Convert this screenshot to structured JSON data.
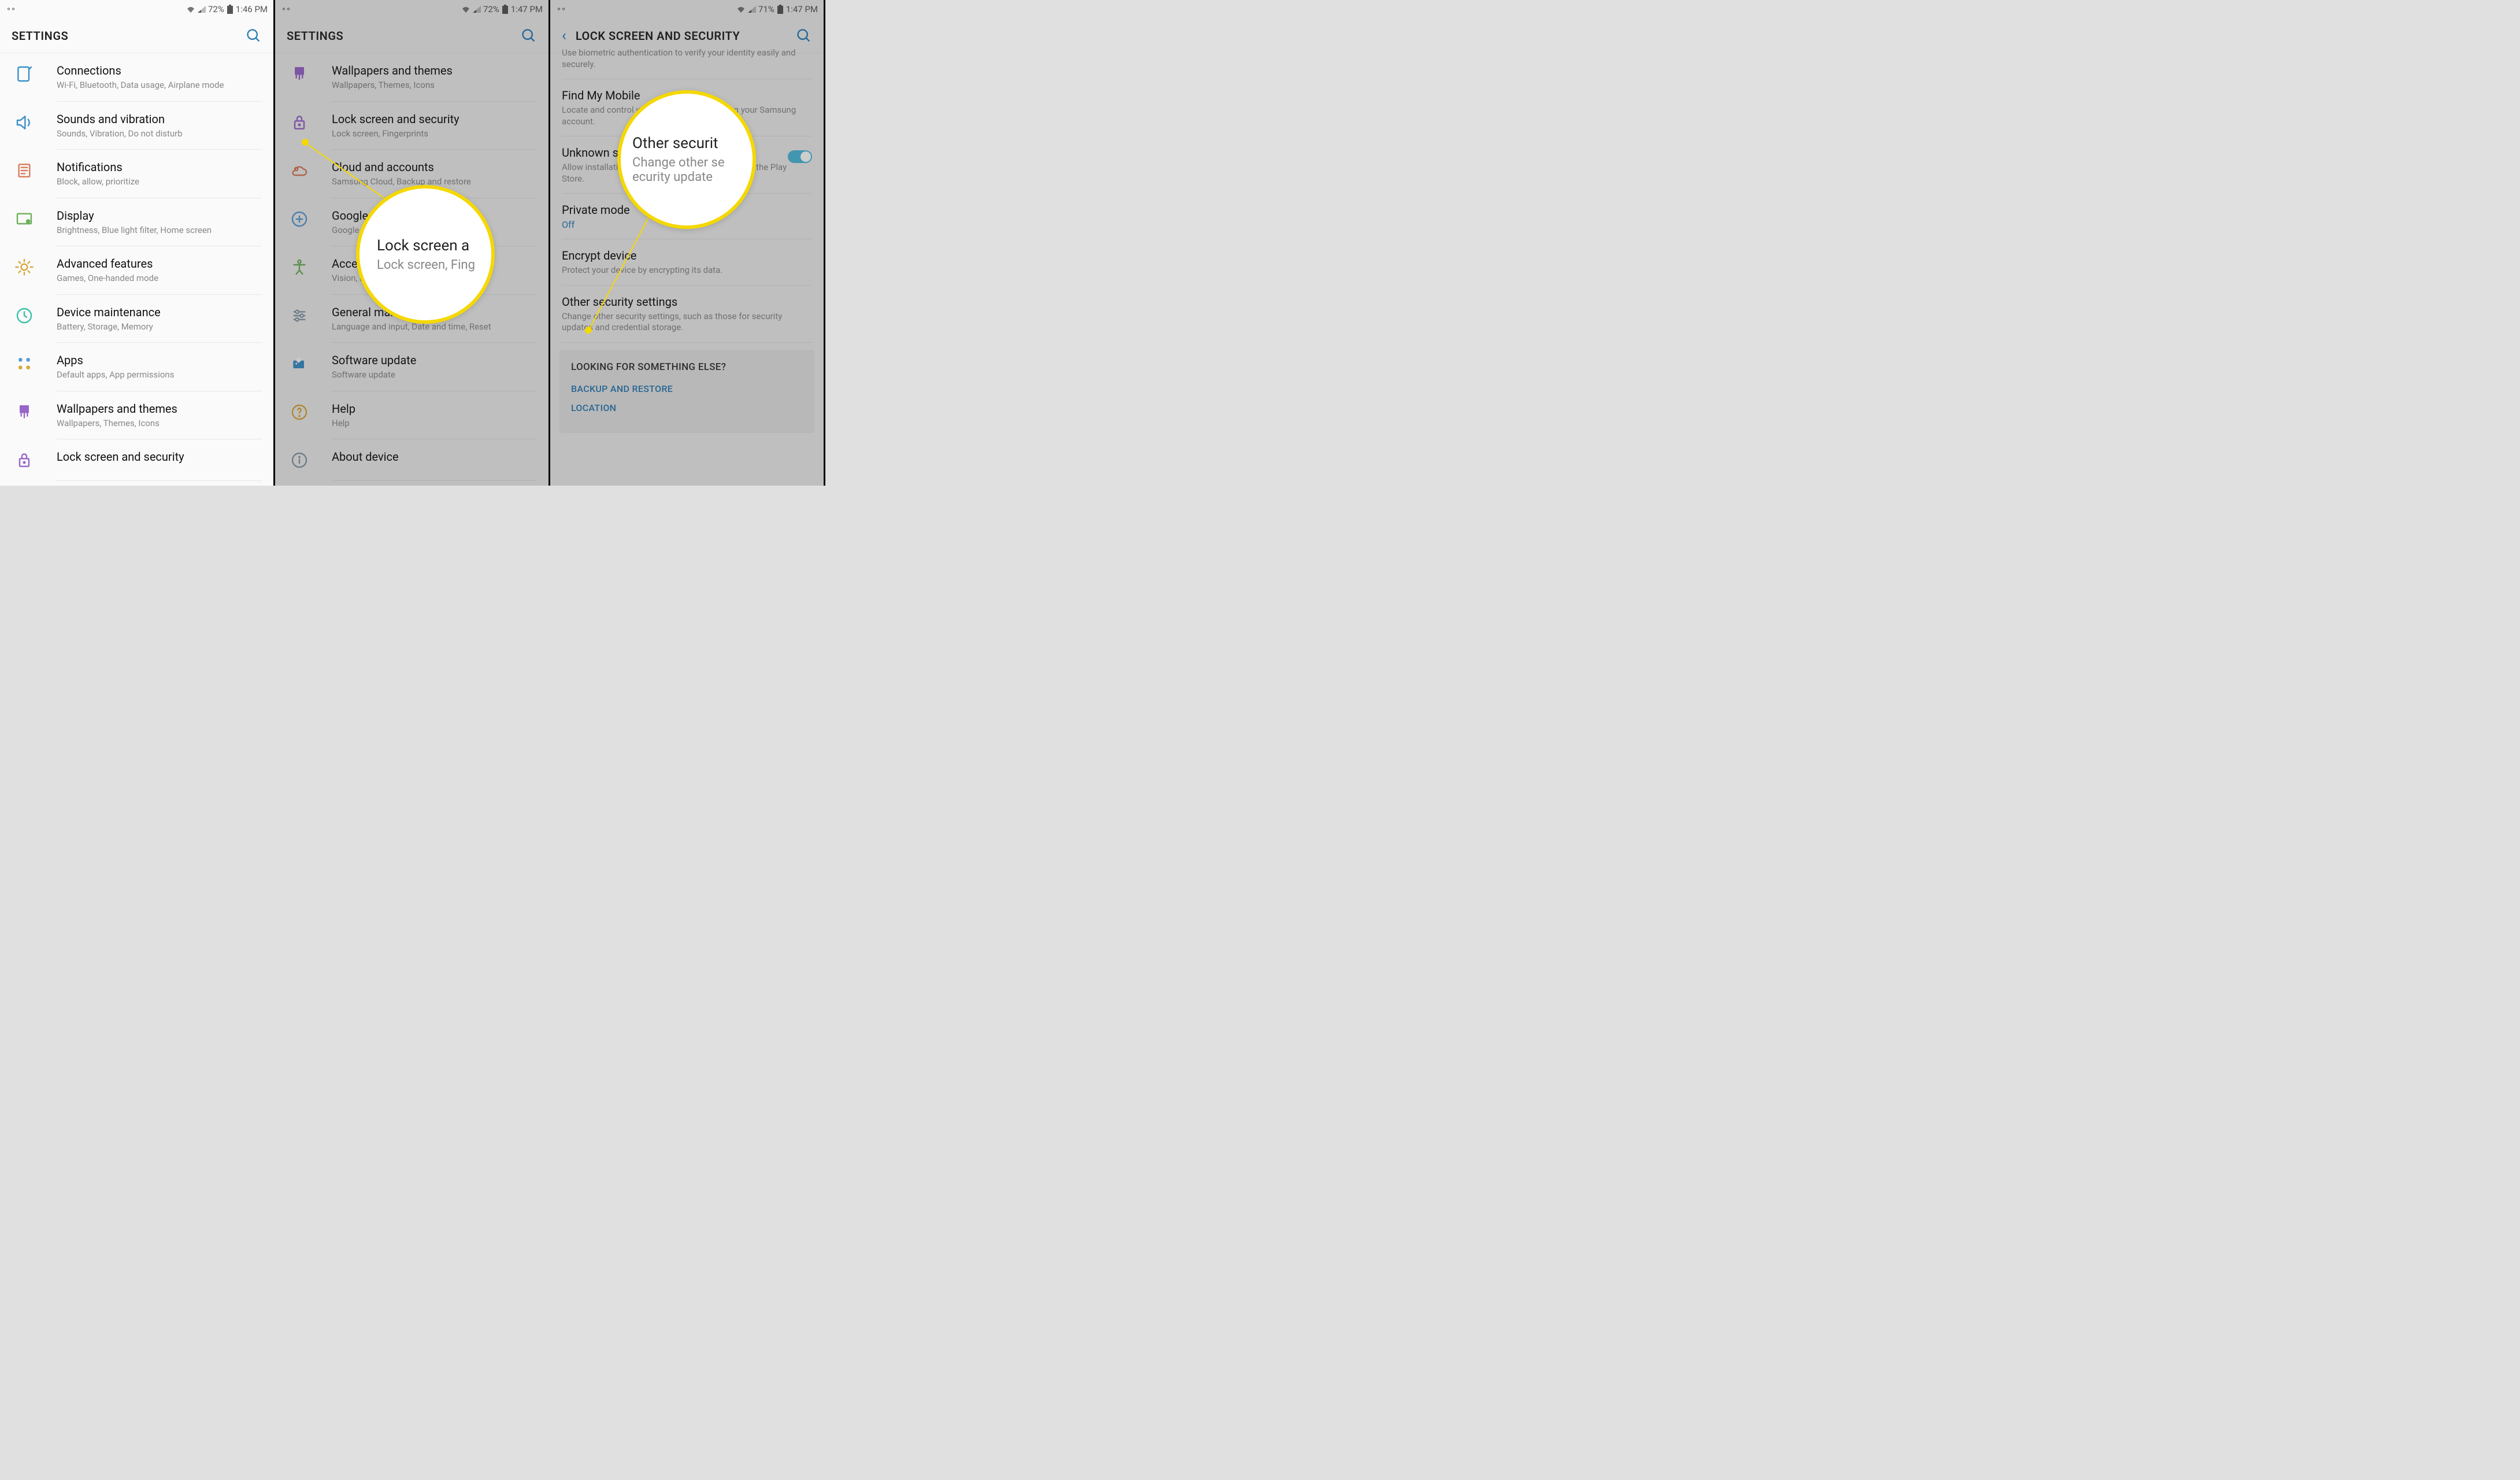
{
  "panel1": {
    "status": {
      "battery": "72%",
      "time": "1:46 PM"
    },
    "header": "SETTINGS",
    "items": [
      {
        "title": "Connections",
        "sub": "Wi-Fi, Bluetooth, Data usage, Airplane mode",
        "icon": "connections",
        "color": "#3a8fc7"
      },
      {
        "title": "Sounds and vibration",
        "sub": "Sounds, Vibration, Do not disturb",
        "icon": "sound",
        "color": "#3a8fc7"
      },
      {
        "title": "Notifications",
        "sub": "Block, allow, prioritize",
        "icon": "notifications",
        "color": "#d87b5c"
      },
      {
        "title": "Display",
        "sub": "Brightness, Blue light filter, Home screen",
        "icon": "display",
        "color": "#6cb05c"
      },
      {
        "title": "Advanced features",
        "sub": "Games, One-handed mode",
        "icon": "advanced",
        "color": "#d8a73a"
      },
      {
        "title": "Device maintenance",
        "sub": "Battery, Storage, Memory",
        "icon": "maintenance",
        "color": "#3bbfa8"
      },
      {
        "title": "Apps",
        "sub": "Default apps, App permissions",
        "icon": "apps",
        "color": "#5b9bd5"
      },
      {
        "title": "Wallpapers and themes",
        "sub": "Wallpapers, Themes, Icons",
        "icon": "wallpaper",
        "color": "#9865c9"
      },
      {
        "title": "Lock screen and security",
        "sub": "",
        "icon": "lock",
        "color": "#9865c9"
      }
    ]
  },
  "panel2": {
    "status": {
      "battery": "72%",
      "time": "1:47 PM"
    },
    "header": "SETTINGS",
    "items": [
      {
        "title": "Wallpapers and themes",
        "sub": "Wallpapers, Themes, Icons",
        "icon": "wallpaper",
        "color": "#9865c9"
      },
      {
        "title": "Lock screen and security",
        "sub": "Lock screen, Fingerprints",
        "icon": "lock",
        "color": "#9865c9"
      },
      {
        "title": "Cloud and accounts",
        "sub": "Samsung Cloud, Backup and restore",
        "icon": "cloud",
        "color": "#d87b5c"
      },
      {
        "title": "Google",
        "sub": "Google settings",
        "icon": "google",
        "color": "#5b9bd5"
      },
      {
        "title": "Accessibility",
        "sub": "Vision, Hearing, Dexterity and interaction",
        "icon": "accessibility",
        "color": "#6cb05c"
      },
      {
        "title": "General management",
        "sub": "Language and input, Date and time, Reset",
        "icon": "general",
        "color": "#8899a6"
      },
      {
        "title": "Software update",
        "sub": "Software update",
        "icon": "update",
        "color": "#3a8fc7"
      },
      {
        "title": "Help",
        "sub": "Help",
        "icon": "help",
        "color": "#d8a73a"
      },
      {
        "title": "About device",
        "sub": "",
        "icon": "about",
        "color": "#8899a6"
      }
    ],
    "callout": {
      "title": "Lock screen a",
      "sub": "Lock screen, Fing"
    }
  },
  "panel3": {
    "status": {
      "battery": "71%",
      "time": "1:47 PM"
    },
    "header": "LOCK SCREEN AND SECURITY",
    "topItem": {
      "sub": "Use biometric authentication to verify your identity easily and securely."
    },
    "items": [
      {
        "title": "Find My Mobile",
        "sub": "Locate and control your device remotely using your Samsung account."
      },
      {
        "title": "Unknown sources",
        "sub": "Allow installation of apps from sources other than the Play Store.",
        "toggle": true
      },
      {
        "title": "Private mode",
        "status": "Off"
      },
      {
        "title": "Encrypt device",
        "sub": "Protect your device by encrypting its data."
      },
      {
        "title": "Other security settings",
        "sub": "Change other security settings, such as those for security updates and credential storage."
      }
    ],
    "footer": {
      "title": "LOOKING FOR SOMETHING ELSE?",
      "links": [
        "BACKUP AND RESTORE",
        "LOCATION"
      ]
    },
    "callout": {
      "title": "Other securit",
      "sub1": "Change other se",
      "sub2": "ecurity update"
    }
  }
}
